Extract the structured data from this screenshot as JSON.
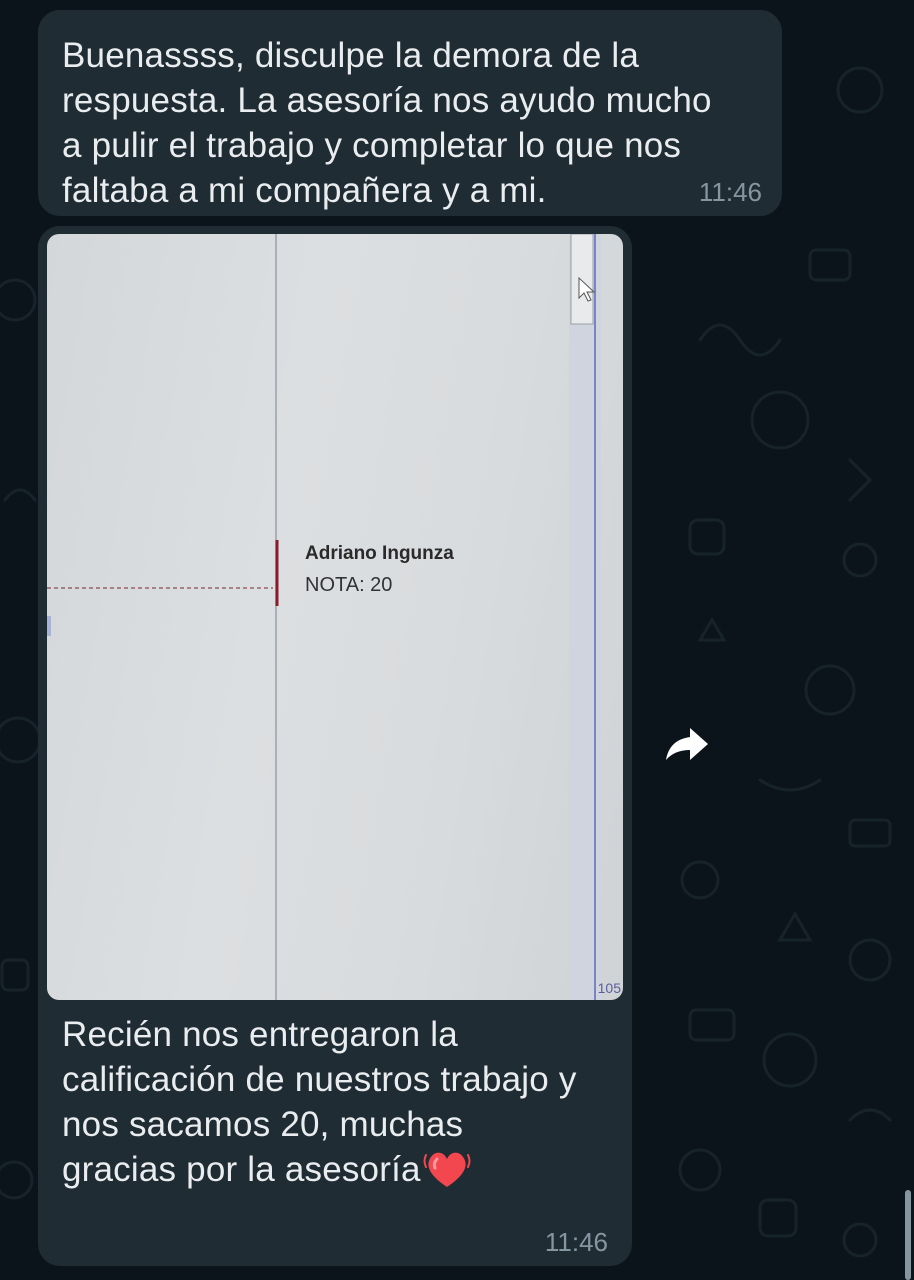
{
  "colors": {
    "background": "#0b141a",
    "bubble": "#202c33",
    "text": "#e9edef",
    "timestamp": "#8696a0"
  },
  "messages": [
    {
      "text": "Buenassss, disculpe la demora de la\nrespuesta. La asesoría nos ayudo mucho\na pulir el trabajo y completar lo que nos\nfaltaba a mi compañera y a mi.",
      "time": "11:46"
    },
    {
      "photo": {
        "name": "Adriano Ingunza",
        "grade": "NOTA: 20",
        "corner_label": "105"
      },
      "text": "Recién nos entregaron la\ncalificación de nuestros trabajo y\nnos sacamos 20, muchas\ngracias por la asesoría",
      "emoji_icon": "beating-heart-icon",
      "time": "11:46"
    }
  ],
  "forward_icon": "forward-arrow-icon"
}
